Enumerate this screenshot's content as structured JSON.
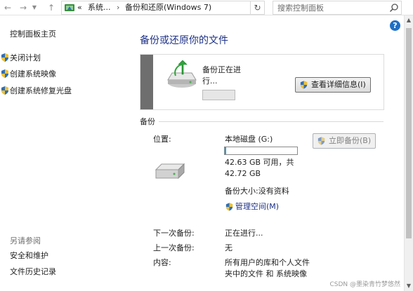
{
  "address_bar": {
    "breadcrumb_prefix": "«",
    "crumb_1": "系统...",
    "crumb_2": "备份和还原(Windows 7)",
    "search_placeholder": "搜索控制面板"
  },
  "sidebar": {
    "home": "控制面板主页",
    "links": [
      "关闭计划",
      "创建系统映像",
      "创建系统修复光盘"
    ],
    "see_also_header": "另请参阅",
    "see_also": [
      "安全和维护",
      "文件历史记录"
    ]
  },
  "main": {
    "title": "备份或还原你的文件",
    "progress": {
      "status_text": "备份正在进行...",
      "fraction_complete": 0.0,
      "details_button": "查看详细信息(I)"
    },
    "backup_section": {
      "header": "备份",
      "location_label": "位置:",
      "location_value": "本地磁盘 (G:)",
      "disk_used_fraction": 0.02,
      "space_line1": "42.63 GB 可用，共",
      "space_line2": "42.72 GB",
      "backup_size": "备份大小:没有资料",
      "manage_space": "管理空间(M)",
      "backup_now_button": "立即备份(B)",
      "next_backup_label": "下一次备份:",
      "next_backup_value": "正在进行...",
      "last_backup_label": "上一次备份:",
      "last_backup_value": "无",
      "contents_label": "内容:",
      "contents_value": "所有用户的库和个人文件夹中的文件 和 系统映像"
    }
  },
  "watermark": "CSDN @墨染青竹梦悠然",
  "colors": {
    "title_blue": "#1e3287",
    "progress_green": "#06b025",
    "stripe_gray": "#6e6e6e",
    "help_blue": "#1f6fc5"
  },
  "icons": [
    "back-arrow-icon",
    "forward-arrow-icon",
    "up-arrow-icon",
    "control-panel-icon",
    "refresh-icon",
    "search-icon",
    "uac-shield-icon",
    "backup-progress-icon",
    "hard-drive-icon",
    "help-icon"
  ]
}
